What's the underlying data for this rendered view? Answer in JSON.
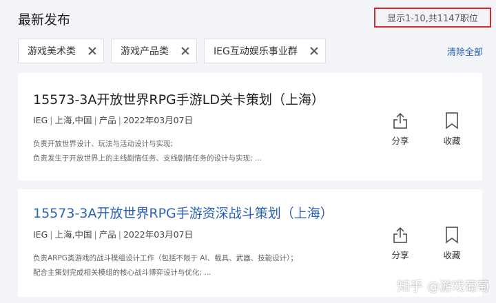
{
  "header": {
    "title": "最新发布",
    "result_count": "显示1-10,共1147职位"
  },
  "filters": {
    "chips": [
      {
        "label": "游戏美术类"
      },
      {
        "label": "游戏产品类"
      },
      {
        "label": "IEG互动娱乐事业群"
      }
    ],
    "clear_all": "清除全部"
  },
  "jobs": [
    {
      "title": "15573-3A开放世界RPG手游LD关卡策划（上海）",
      "bg": "IEG",
      "location": "上海,中国",
      "category": "产品",
      "date": "2022年03月07日",
      "desc_line1": "负责开放世界设计、玩法与活动设计与实现;",
      "desc_line2": "负责发生于开放世界上的主线剧情任务、支线剧情任务的设计与实现; ...",
      "share": "分享",
      "collect": "收藏"
    },
    {
      "title": "15573-3A开放世界RPG手游资深战斗策划（上海）",
      "bg": "IEG",
      "location": "上海,中国",
      "category": "产品",
      "date": "2022年03月07日",
      "desc_line1": "负责ARPG类游戏的战斗模组设计工作（包括不限于 AI、载具、武器、技能设计）；",
      "desc_line2": "配合主策划完成相关模组的核心战斗博弈设计与优化;   ...",
      "share": "分享",
      "collect": "收藏"
    }
  ],
  "watermark": {
    "brand": "知乎",
    "author": "@游戏葡萄"
  },
  "colors": {
    "accent_link": "#2a62b5",
    "highlight_border": "#d9262c",
    "page_bg": "#f2f4f7"
  }
}
